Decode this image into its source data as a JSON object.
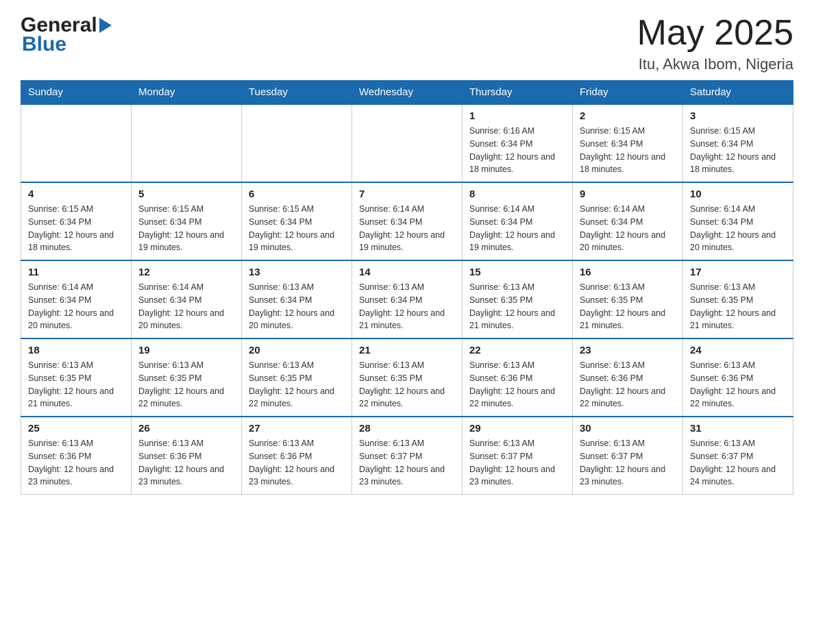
{
  "header": {
    "logo": {
      "general": "General",
      "blue": "Blue"
    },
    "title": "May 2025",
    "subtitle": "Itu, Akwa Ibom, Nigeria"
  },
  "calendar": {
    "days_of_week": [
      "Sunday",
      "Monday",
      "Tuesday",
      "Wednesday",
      "Thursday",
      "Friday",
      "Saturday"
    ],
    "weeks": [
      [
        {
          "day": "",
          "info": ""
        },
        {
          "day": "",
          "info": ""
        },
        {
          "day": "",
          "info": ""
        },
        {
          "day": "",
          "info": ""
        },
        {
          "day": "1",
          "info": "Sunrise: 6:16 AM\nSunset: 6:34 PM\nDaylight: 12 hours and 18 minutes."
        },
        {
          "day": "2",
          "info": "Sunrise: 6:15 AM\nSunset: 6:34 PM\nDaylight: 12 hours and 18 minutes."
        },
        {
          "day": "3",
          "info": "Sunrise: 6:15 AM\nSunset: 6:34 PM\nDaylight: 12 hours and 18 minutes."
        }
      ],
      [
        {
          "day": "4",
          "info": "Sunrise: 6:15 AM\nSunset: 6:34 PM\nDaylight: 12 hours and 18 minutes."
        },
        {
          "day": "5",
          "info": "Sunrise: 6:15 AM\nSunset: 6:34 PM\nDaylight: 12 hours and 19 minutes."
        },
        {
          "day": "6",
          "info": "Sunrise: 6:15 AM\nSunset: 6:34 PM\nDaylight: 12 hours and 19 minutes."
        },
        {
          "day": "7",
          "info": "Sunrise: 6:14 AM\nSunset: 6:34 PM\nDaylight: 12 hours and 19 minutes."
        },
        {
          "day": "8",
          "info": "Sunrise: 6:14 AM\nSunset: 6:34 PM\nDaylight: 12 hours and 19 minutes."
        },
        {
          "day": "9",
          "info": "Sunrise: 6:14 AM\nSunset: 6:34 PM\nDaylight: 12 hours and 20 minutes."
        },
        {
          "day": "10",
          "info": "Sunrise: 6:14 AM\nSunset: 6:34 PM\nDaylight: 12 hours and 20 minutes."
        }
      ],
      [
        {
          "day": "11",
          "info": "Sunrise: 6:14 AM\nSunset: 6:34 PM\nDaylight: 12 hours and 20 minutes."
        },
        {
          "day": "12",
          "info": "Sunrise: 6:14 AM\nSunset: 6:34 PM\nDaylight: 12 hours and 20 minutes."
        },
        {
          "day": "13",
          "info": "Sunrise: 6:13 AM\nSunset: 6:34 PM\nDaylight: 12 hours and 20 minutes."
        },
        {
          "day": "14",
          "info": "Sunrise: 6:13 AM\nSunset: 6:34 PM\nDaylight: 12 hours and 21 minutes."
        },
        {
          "day": "15",
          "info": "Sunrise: 6:13 AM\nSunset: 6:35 PM\nDaylight: 12 hours and 21 minutes."
        },
        {
          "day": "16",
          "info": "Sunrise: 6:13 AM\nSunset: 6:35 PM\nDaylight: 12 hours and 21 minutes."
        },
        {
          "day": "17",
          "info": "Sunrise: 6:13 AM\nSunset: 6:35 PM\nDaylight: 12 hours and 21 minutes."
        }
      ],
      [
        {
          "day": "18",
          "info": "Sunrise: 6:13 AM\nSunset: 6:35 PM\nDaylight: 12 hours and 21 minutes."
        },
        {
          "day": "19",
          "info": "Sunrise: 6:13 AM\nSunset: 6:35 PM\nDaylight: 12 hours and 22 minutes."
        },
        {
          "day": "20",
          "info": "Sunrise: 6:13 AM\nSunset: 6:35 PM\nDaylight: 12 hours and 22 minutes."
        },
        {
          "day": "21",
          "info": "Sunrise: 6:13 AM\nSunset: 6:35 PM\nDaylight: 12 hours and 22 minutes."
        },
        {
          "day": "22",
          "info": "Sunrise: 6:13 AM\nSunset: 6:36 PM\nDaylight: 12 hours and 22 minutes."
        },
        {
          "day": "23",
          "info": "Sunrise: 6:13 AM\nSunset: 6:36 PM\nDaylight: 12 hours and 22 minutes."
        },
        {
          "day": "24",
          "info": "Sunrise: 6:13 AM\nSunset: 6:36 PM\nDaylight: 12 hours and 22 minutes."
        }
      ],
      [
        {
          "day": "25",
          "info": "Sunrise: 6:13 AM\nSunset: 6:36 PM\nDaylight: 12 hours and 23 minutes."
        },
        {
          "day": "26",
          "info": "Sunrise: 6:13 AM\nSunset: 6:36 PM\nDaylight: 12 hours and 23 minutes."
        },
        {
          "day": "27",
          "info": "Sunrise: 6:13 AM\nSunset: 6:36 PM\nDaylight: 12 hours and 23 minutes."
        },
        {
          "day": "28",
          "info": "Sunrise: 6:13 AM\nSunset: 6:37 PM\nDaylight: 12 hours and 23 minutes."
        },
        {
          "day": "29",
          "info": "Sunrise: 6:13 AM\nSunset: 6:37 PM\nDaylight: 12 hours and 23 minutes."
        },
        {
          "day": "30",
          "info": "Sunrise: 6:13 AM\nSunset: 6:37 PM\nDaylight: 12 hours and 23 minutes."
        },
        {
          "day": "31",
          "info": "Sunrise: 6:13 AM\nSunset: 6:37 PM\nDaylight: 12 hours and 24 minutes."
        }
      ]
    ]
  }
}
